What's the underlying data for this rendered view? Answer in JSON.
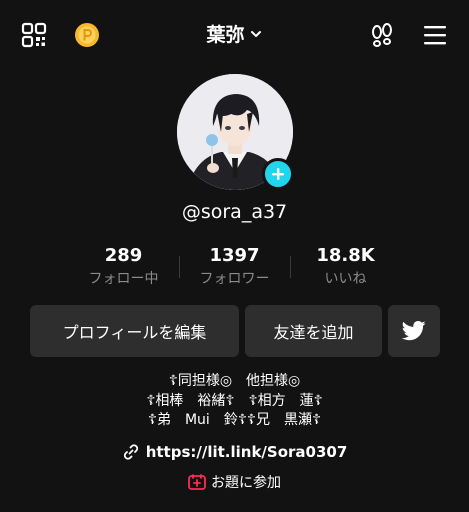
{
  "header": {
    "title": "葉弥",
    "icons": {
      "left_1": "qr-code-icon",
      "left_2": "coin-icon",
      "right_1": "footprint-icon",
      "right_2": "menu-icon"
    }
  },
  "profile": {
    "handle": "@sora_a37",
    "avatar": "avatar",
    "add_badge_icon": "plus-icon"
  },
  "stats": [
    {
      "value": "289",
      "label": "フォロー中"
    },
    {
      "value": "1397",
      "label": "フォロワー"
    },
    {
      "value": "18.8K",
      "label": "いいね"
    }
  ],
  "buttons": {
    "edit_profile": "プロフィールを編集",
    "add_friends": "友達を追加",
    "twitter_icon": "twitter-icon"
  },
  "bio": {
    "lines": [
      "☦同担様◎　他担様◎",
      "☦相棒　裕緒☦　☦相方　蓮☦",
      "☦弟　Mui　鈴☦☦兄　黒瀬☦"
    ],
    "link": "https://lit.link/Sora0307",
    "topic": "お題に参加"
  },
  "colors": {
    "background": "#121212",
    "button": "#2e2e2e",
    "accent_cyan": "#20d5ec",
    "topic_red": "#fe2c55",
    "muted_text": "#8a8a8a",
    "coin_gold": "#f6b92b"
  }
}
